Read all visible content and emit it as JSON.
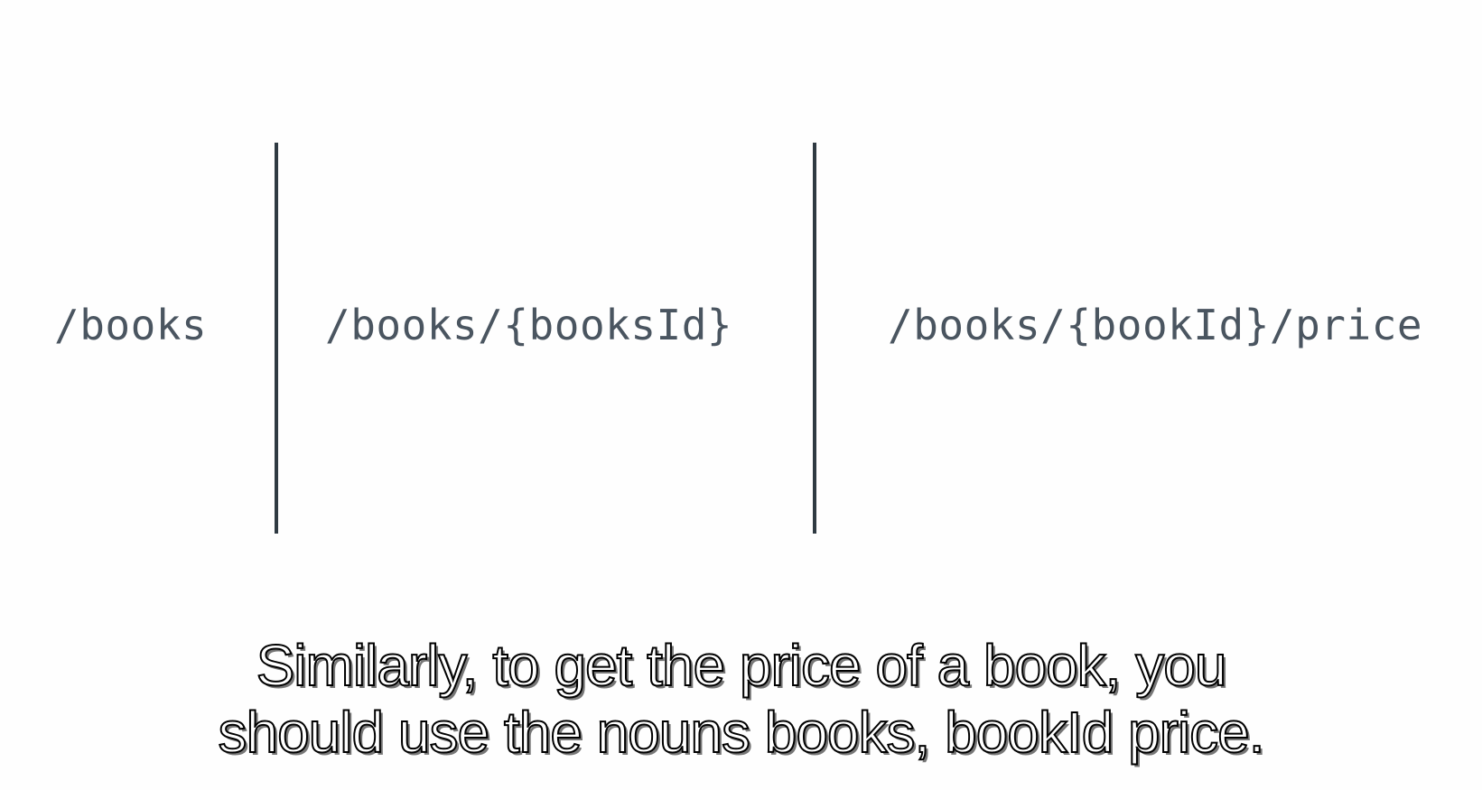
{
  "paths": [
    "/books",
    "/books/{booksId}",
    "/books/{bookId}/price"
  ],
  "subtitle": {
    "line1": "Similarly, to get the price of a book, you",
    "line2": "should use the nouns books, bookId price."
  },
  "colors": {
    "background": "#fefefe",
    "path_text": "#4a5560",
    "divider": "#2f3a42",
    "subtitle_fill": "#ffffff",
    "subtitle_outline": "#000000"
  }
}
